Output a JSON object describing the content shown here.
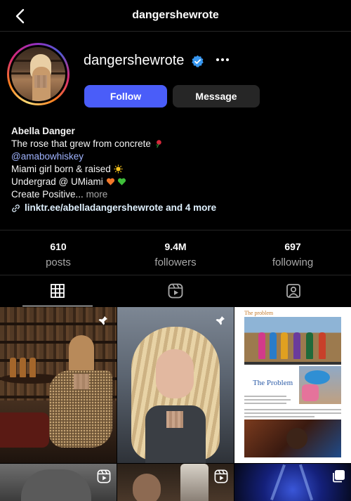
{
  "header": {
    "title": "dangershewrote",
    "back_icon": "chevron-left-icon"
  },
  "profile": {
    "username": "dangershewrote",
    "verified": true,
    "follow_label": "Follow",
    "message_label": "Message",
    "accent_color": "#4a5df9"
  },
  "bio": {
    "name": "Abella Danger",
    "line1": "The rose that grew from concrete",
    "mention": "@amabowhiskey",
    "line3": "Miami girl born & raised",
    "line4": "Undergrad @ UMiami",
    "line5": "Create Positive...",
    "more_label": "more",
    "link_text": "linktr.ee/abelladangershewrote and 4 more"
  },
  "stats": [
    {
      "value": "610",
      "label": "posts"
    },
    {
      "value": "9.4M",
      "label": "followers"
    },
    {
      "value": "697",
      "label": "following"
    }
  ],
  "tabs": [
    {
      "name": "posts-grid",
      "icon": "grid-icon",
      "active": true
    },
    {
      "name": "reels",
      "icon": "reels-icon",
      "active": false
    },
    {
      "name": "tagged",
      "icon": "tagged-user-icon",
      "active": false
    }
  ],
  "posts": [
    {
      "badge": "pin-icon"
    },
    {
      "badge": "pin-icon"
    },
    {
      "badge": "",
      "header_text": "The problem",
      "title_text": "The Problem"
    },
    {
      "badge": "reel-icon"
    },
    {
      "badge": "reel-icon"
    },
    {
      "badge": "multi-image-icon"
    }
  ]
}
